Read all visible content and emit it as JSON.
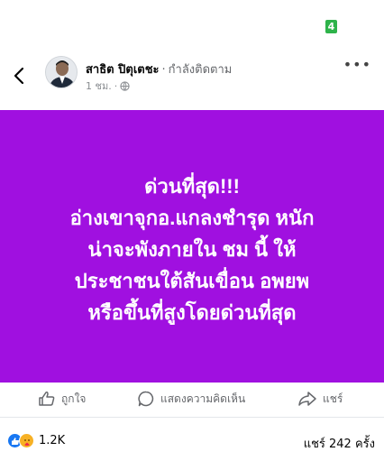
{
  "status": {
    "channel_badge": "4"
  },
  "post": {
    "author": "สาธิต ปิตุเตชะ",
    "follow_status": "กำลังติดตาม",
    "time": "1 ชม.",
    "text_lines": [
      "ด่วนที่สุด!!!",
      "อ่างเขาจุกอ.แกลงชำรุด หนัก",
      "น่าจะพังภายใน ชม นี้ ให้",
      "ประชาชนใต้สันเขื่อน อพยพ",
      "หรือขึ้นที่สูงโดยด่วนที่สุด"
    ],
    "background_color": "#a010e0"
  },
  "actions": {
    "like": "ถูกใจ",
    "comment": "แสดงความคิดเห็น",
    "share": "แชร์"
  },
  "stats": {
    "reactions_count": "1.2K",
    "shares": "แชร์ 242 ครั้ง"
  },
  "icons": {
    "back": "chevron-left-icon",
    "privacy": "globe-icon",
    "more": "more-icon",
    "like": "thumbs-up-icon",
    "comment": "comment-icon",
    "share": "share-icon"
  }
}
